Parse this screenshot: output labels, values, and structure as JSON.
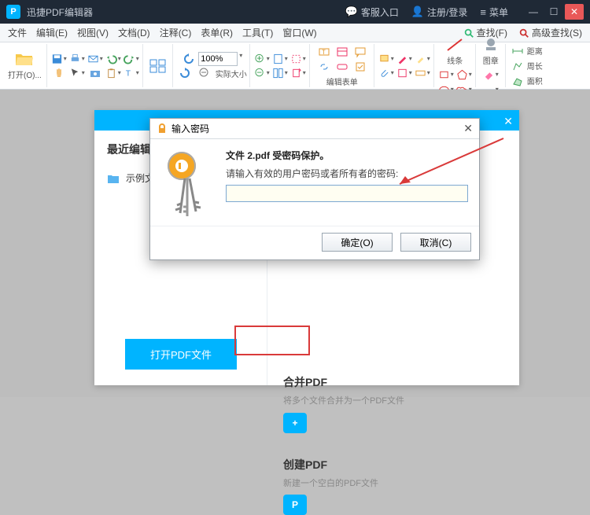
{
  "titlebar": {
    "app_name": "迅捷PDF编辑器",
    "service": "客服入口",
    "login": "注册/登录",
    "menu": "菜单"
  },
  "menubar": {
    "items": [
      "文件",
      "编辑(E)",
      "视图(V)",
      "文档(D)",
      "注释(C)",
      "表单(R)",
      "工具(T)",
      "窗口(W)"
    ],
    "search_label": "查找(F)",
    "adv_search_label": "高级查找(S)"
  },
  "ribbon": {
    "open_label": "打开(O)...",
    "zoom_value": "100%",
    "fit_label": "实际大小",
    "edit_form_label": "编辑表单",
    "line_label": "线条",
    "image_label": "图章",
    "distance_label": "距离",
    "perimeter_label": "周长",
    "area_label": "面积"
  },
  "panel": {
    "recent_title": "最近编辑",
    "file_name": "示例文",
    "open_btn": "打开PDF文件",
    "cards": [
      {
        "title": "合并PDF",
        "desc": "将多个文件合并为一个PDF文件",
        "icon": "+"
      },
      {
        "title": "创建PDF",
        "desc": "新建一个空白的PDF文件",
        "icon": "P"
      }
    ]
  },
  "dialog": {
    "title": "输入密码",
    "line1_prefix": "文件 ",
    "line1_file": "2.pdf",
    "line1_suffix": " 受密码保护。",
    "line2": "请输入有效的用户密码或者所有者的密码:",
    "ok": "确定(O)",
    "cancel": "取消(C)"
  }
}
